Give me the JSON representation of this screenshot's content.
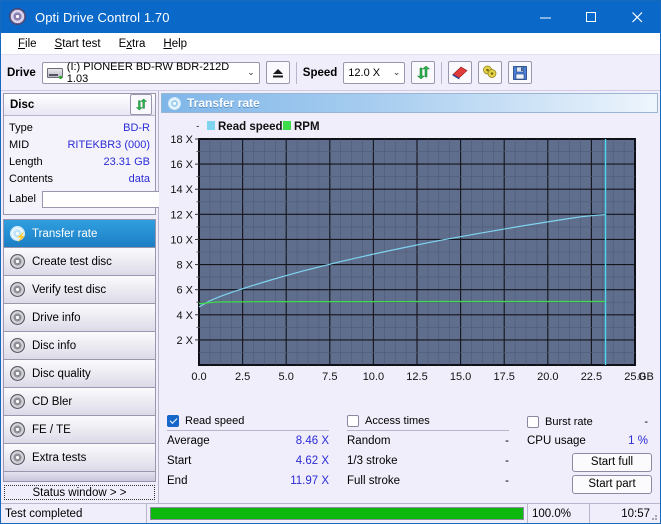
{
  "window": {
    "title": "Opti Drive Control 1.70",
    "icon": "disc-icon",
    "minimize": "−",
    "maximize": "□",
    "close": "✕"
  },
  "menu": [
    {
      "label": "File",
      "accel": "F"
    },
    {
      "label": "Start test",
      "accel": "S"
    },
    {
      "label": "Extra",
      "accel": "x"
    },
    {
      "label": "Help",
      "accel": "H"
    }
  ],
  "toolbar": {
    "drive_label": "Drive",
    "drive_value": "(I:)  PIONEER BD-RW   BDR-212D 1.03",
    "eject_icon": "eject-icon",
    "speed_label": "Speed",
    "speed_value": "12.0 X",
    "refresh_icon": "refresh-icon",
    "erase_icon": "eraser-icon",
    "settings_icon": "bell-icon",
    "save_icon": "save-icon",
    "caret": "⌄"
  },
  "disc": {
    "title": "Disc",
    "refresh_icon": "refresh-icon",
    "rows": [
      {
        "key": "Type",
        "value": "BD-R"
      },
      {
        "key": "MID",
        "value": "RITEKBR3 (000)"
      },
      {
        "key": "Length",
        "value": "23.31 GB"
      },
      {
        "key": "Contents",
        "value": "data"
      }
    ],
    "label_key": "Label",
    "label_value": "",
    "label_placeholder": "",
    "label_button_icon": "disc-icon"
  },
  "sidebar": {
    "items": [
      {
        "label": "Transfer rate",
        "active": true
      },
      {
        "label": "Create test disc",
        "active": false
      },
      {
        "label": "Verify test disc",
        "active": false
      },
      {
        "label": "Drive info",
        "active": false
      },
      {
        "label": "Disc info",
        "active": false
      },
      {
        "label": "Disc quality",
        "active": false
      },
      {
        "label": "CD Bler",
        "active": false
      },
      {
        "label": "FE / TE",
        "active": false
      },
      {
        "label": "Extra tests",
        "active": false
      }
    ],
    "status_window": "Status window > >"
  },
  "panel": {
    "title": "Transfer rate",
    "icon": "disc-icon"
  },
  "chart_data": {
    "type": "line",
    "title": "Transfer rate",
    "xlabel": "GB",
    "ylabel": "X",
    "xlim": [
      0.0,
      25.0
    ],
    "ylim": [
      0,
      18
    ],
    "xticks": [
      "0.0",
      "2.5",
      "5.0",
      "7.5",
      "10.0",
      "12.5",
      "15.0",
      "17.5",
      "20.0",
      "22.5",
      "25.0"
    ],
    "xtick_values": [
      0,
      2.5,
      5,
      7.5,
      10,
      12.5,
      15,
      17.5,
      20,
      22.5,
      25
    ],
    "x_unit": "GB",
    "yticks": [
      "2 X",
      "4 X",
      "6 X",
      "8 X",
      "10 X",
      "12 X",
      "14 X",
      "16 X",
      "18 X"
    ],
    "ytick_values": [
      2,
      4,
      6,
      8,
      10,
      12,
      14,
      16,
      18
    ],
    "grid": true,
    "legend_position": "top-left",
    "plot_bg": "#5f6e8c",
    "series": [
      {
        "name": "Read speed",
        "color": "#7fd4f0",
        "x": [
          0.0,
          0.6,
          1.2,
          2.0,
          3.0,
          4.0,
          5.0,
          6.0,
          7.0,
          8.0,
          9.0,
          10.0,
          11.0,
          12.0,
          13.0,
          14.0,
          15.0,
          16.0,
          17.0,
          18.0,
          19.0,
          20.0,
          21.0,
          22.0,
          23.0,
          23.31
        ],
        "values": [
          4.62,
          5.1,
          5.45,
          5.85,
          6.3,
          6.72,
          7.12,
          7.5,
          7.85,
          8.2,
          8.52,
          8.83,
          9.13,
          9.42,
          9.7,
          9.97,
          10.22,
          10.47,
          10.71,
          10.95,
          11.18,
          11.4,
          11.62,
          11.82,
          11.95,
          11.97
        ]
      },
      {
        "name": "RPM",
        "color": "#3ddc4a",
        "x": [
          0.0,
          1.0,
          3.0,
          6.0,
          10.0,
          14.0,
          18.0,
          21.0,
          23.0,
          23.31
        ],
        "values": [
          4.88,
          5.02,
          5.04,
          5.05,
          5.05,
          5.06,
          5.06,
          5.06,
          5.06,
          5.06
        ]
      }
    ],
    "marker_line": {
      "x": 23.31,
      "color": "#48d8f0"
    },
    "legend": [
      {
        "label": "Read speed",
        "color": "#7fd4f0"
      },
      {
        "label": "RPM",
        "color": "#3ddc4a"
      }
    ]
  },
  "results": {
    "read_speed": {
      "title": "Read speed",
      "checked": true,
      "rows": [
        {
          "key": "Average",
          "value": "8.46 X"
        },
        {
          "key": "Start",
          "value": "4.62 X"
        },
        {
          "key": "End",
          "value": "11.97 X"
        }
      ]
    },
    "access_times": {
      "title": "Access times",
      "checked": false,
      "rows": [
        {
          "key": "Random",
          "value": "-"
        },
        {
          "key": "1/3 stroke",
          "value": "-"
        },
        {
          "key": "Full stroke",
          "value": "-"
        }
      ]
    },
    "burst": {
      "title": "Burst rate",
      "checked": false,
      "value": "-",
      "cpu_key": "CPU usage",
      "cpu_value": "1 %",
      "start_full": "Start full",
      "start_part": "Start part"
    }
  },
  "statusbar": {
    "text": "Test completed",
    "percent_label": "100.0%",
    "percent_value": 100,
    "time": "10:57",
    "fill_color": "#0bb80b"
  }
}
